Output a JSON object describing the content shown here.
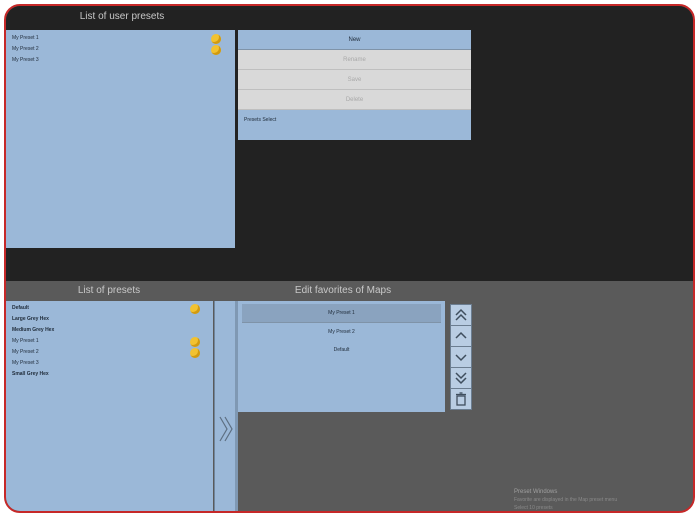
{
  "user_presets": {
    "header": "List of user presets",
    "items": [
      {
        "label": "My Preset 1",
        "starred": true
      },
      {
        "label": "My Preset 2",
        "starred": true
      },
      {
        "label": "My Preset 3",
        "starred": false
      }
    ]
  },
  "actions": {
    "new": "New",
    "rename": "Rename",
    "save": "Save",
    "delete": "Delete",
    "footer": "Presets Select"
  },
  "presets": {
    "header": "List of presets",
    "items": [
      {
        "label": "Default",
        "starred": true,
        "bold": true
      },
      {
        "label": "Large Grey Hex",
        "starred": false,
        "bold": true
      },
      {
        "label": "Medium Grey Hex",
        "starred": false,
        "bold": true
      },
      {
        "label": "My Preset 1",
        "starred": true,
        "bold": false
      },
      {
        "label": "My Preset 2",
        "starred": true,
        "bold": false
      },
      {
        "label": "My Preset 3",
        "starred": false,
        "bold": false
      },
      {
        "label": "Small Grey Hex",
        "starred": false,
        "bold": true
      }
    ]
  },
  "favorites": {
    "header": "Edit favorites of Maps",
    "items": [
      "My Preset 1",
      "My Preset 2",
      "Default"
    ],
    "selected_index": 0
  },
  "footer": {
    "title": "Preset Windows",
    "line1": "Favorite are displayed in the Map preset menu",
    "line2": "Select 10 presets"
  },
  "icons": {
    "move_top": "double-chevron-up-icon",
    "move_up": "chevron-up-icon",
    "move_down": "chevron-down-icon",
    "move_bottom": "double-chevron-down-icon",
    "delete": "trash-icon",
    "transfer": "double-chevron-right-icon",
    "favorite": "star-icon"
  },
  "colors": {
    "frame": "#c62828",
    "panel": "#9bb8d8",
    "top_bg": "#222222",
    "bottom_bg": "#5a5a5a",
    "star": "#f2c230"
  }
}
